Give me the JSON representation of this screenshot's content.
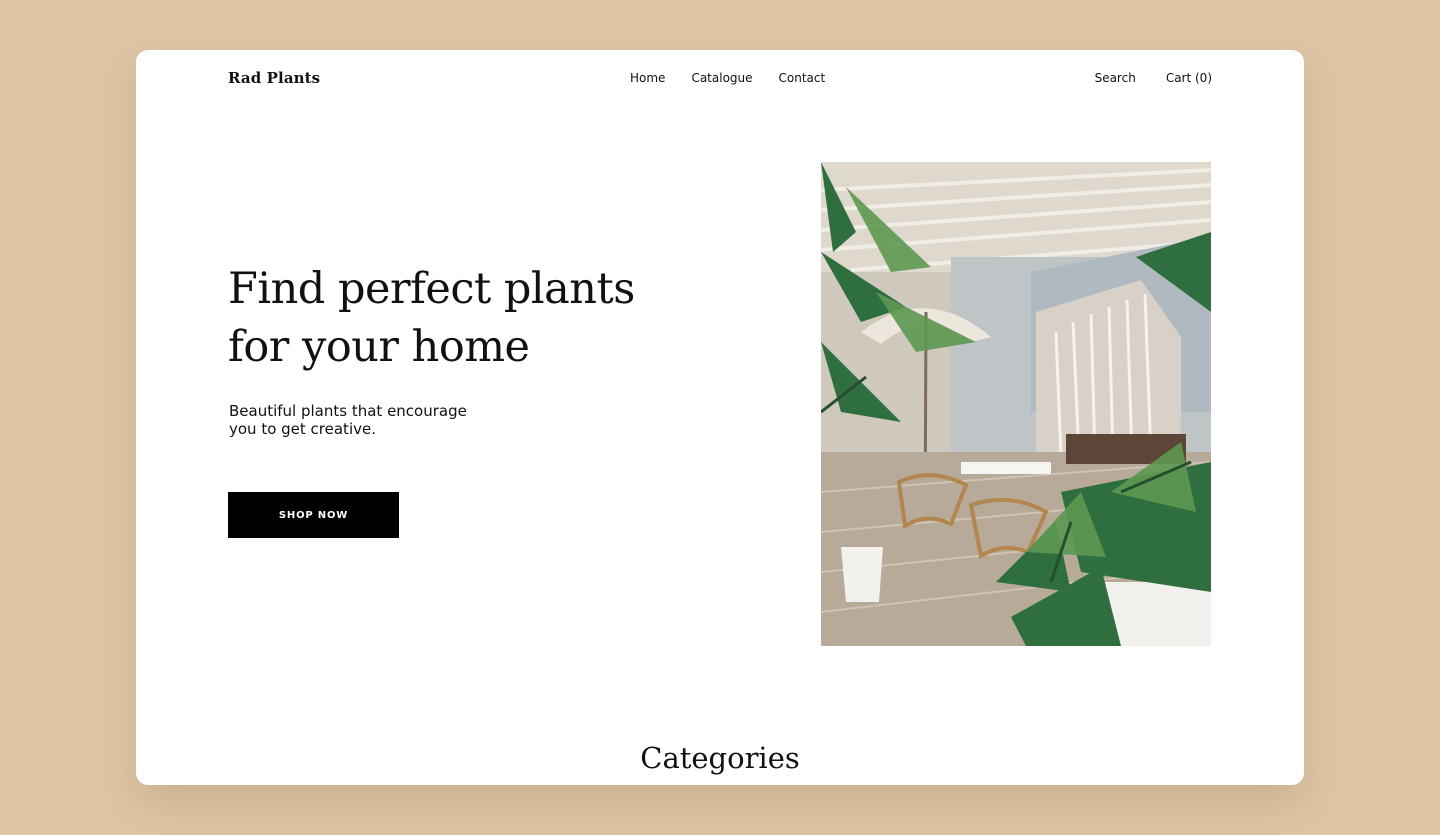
{
  "theme": {
    "page_background": "#ddc5a5",
    "card_background": "#ffffff",
    "text_color": "#111111",
    "button_background": "#000000",
    "button_text": "#ffffff"
  },
  "header": {
    "brand": "Rad Plants",
    "nav": [
      {
        "label": "Home"
      },
      {
        "label": "Catalogue"
      },
      {
        "label": "Contact"
      }
    ],
    "search_label": "Search",
    "cart_label": "Cart (0)"
  },
  "hero": {
    "title_line1": "Find perfect plants",
    "title_line2": "for your home",
    "subtitle_line1": "Beautiful plants that encourage",
    "subtitle_line2": "you to get creative.",
    "cta_label": "SHOP NOW",
    "image": {
      "icon": "patio-plants-photo"
    }
  },
  "categories": {
    "heading": "Categories"
  }
}
